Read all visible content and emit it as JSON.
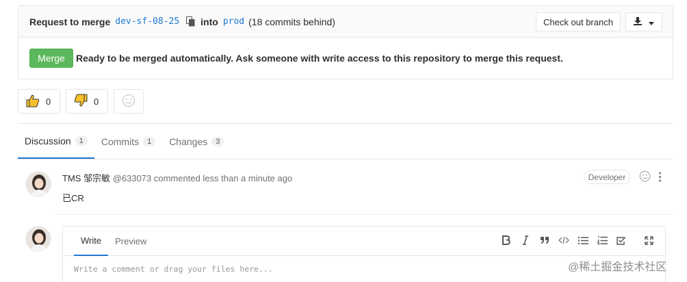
{
  "merge_request": {
    "request_label": "Request to merge",
    "source_branch": "dev-sf-08-25",
    "into_label": "into",
    "target_branch": "prod",
    "behind_text": "(18 commits behind)",
    "checkout_label": "Check out branch",
    "merge_label": "Merge",
    "status_text": "Ready to be merged automatically. Ask someone with write access to this repository to merge this request."
  },
  "awards": {
    "thumbsup_count": "0",
    "thumbsdown_count": "0"
  },
  "tabs": [
    {
      "label": "Discussion",
      "count": "1"
    },
    {
      "label": "Commits",
      "count": "1"
    },
    {
      "label": "Changes",
      "count": "3"
    }
  ],
  "note": {
    "author": "TMS 邹宗敏",
    "meta": "@633073 commented less than a minute ago",
    "role": "Developer",
    "body": "已CR"
  },
  "editor": {
    "write_label": "Write",
    "preview_label": "Preview",
    "placeholder": "Write a comment or drag your files here..."
  },
  "watermark": "@稀土掘金技术社区",
  "colors": {
    "accent": "#1f78d1",
    "merge": "#5cb85c"
  }
}
